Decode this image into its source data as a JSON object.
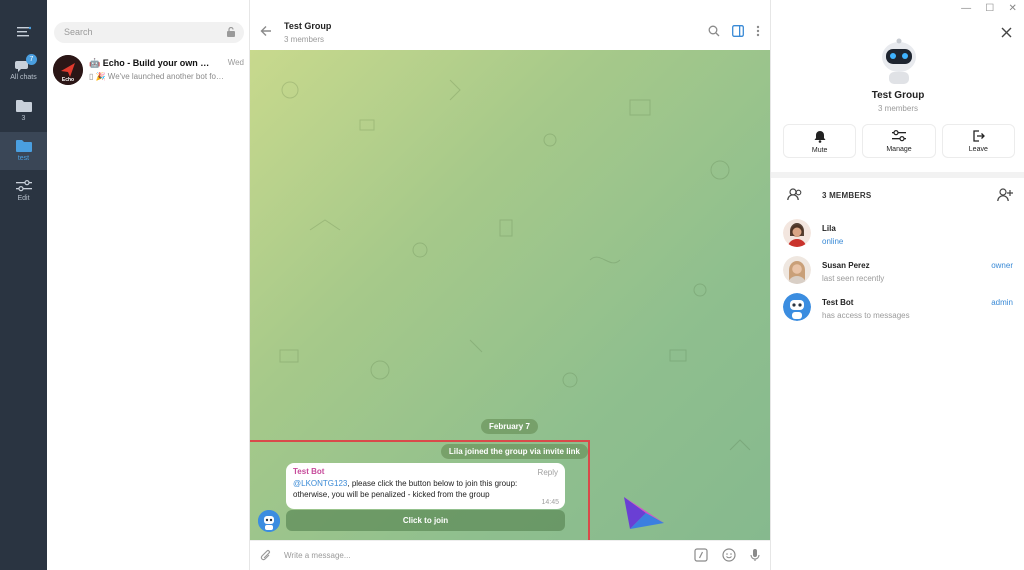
{
  "rail": {
    "items": [
      {
        "label": "All chats",
        "badge": "7",
        "icon": "chat-bubbles-icon"
      },
      {
        "label": "3",
        "icon": "folder-icon"
      },
      {
        "label": "test",
        "icon": "folder-icon"
      },
      {
        "label": "Edit",
        "icon": "sliders-icon"
      }
    ]
  },
  "search": {
    "placeholder": "Search"
  },
  "chats": [
    {
      "name": "Echo - Build your own smar…",
      "date": "Wed",
      "preview": "🎉 We've launched another bot fo…",
      "avatar_text": "Echo"
    }
  ],
  "header": {
    "title": "Test Group",
    "subtitle": "3 members"
  },
  "messages": {
    "date": "February 7",
    "service": "Lila joined the group via invite link",
    "bot": {
      "sender": "Test Bot",
      "reply": "Reply",
      "mention": "@LKONTG123",
      "text": ", please click the button below to join this group: otherwise, you will be penalized - kicked from the group",
      "time": "14:45",
      "button": "Click to join"
    }
  },
  "composer": {
    "placeholder": "Write a message..."
  },
  "info": {
    "title": "Test Group",
    "subtitle": "3 members",
    "actions": [
      {
        "label": "Mute",
        "icon": "bell-icon"
      },
      {
        "label": "Manage",
        "icon": "sliders-icon"
      },
      {
        "label": "Leave",
        "icon": "exit-icon"
      }
    ],
    "members_header": "3 MEMBERS",
    "members": [
      {
        "name": "Lila",
        "status": "online",
        "role": ""
      },
      {
        "name": "Susan Perez",
        "status": "last seen recently",
        "role": "owner"
      },
      {
        "name": "Test Bot",
        "status": "has access to messages",
        "role": "admin"
      }
    ]
  },
  "colors": {
    "accent": "#3a8ad6",
    "rail": "#2a3441",
    "highlight": "#d94a4a"
  }
}
